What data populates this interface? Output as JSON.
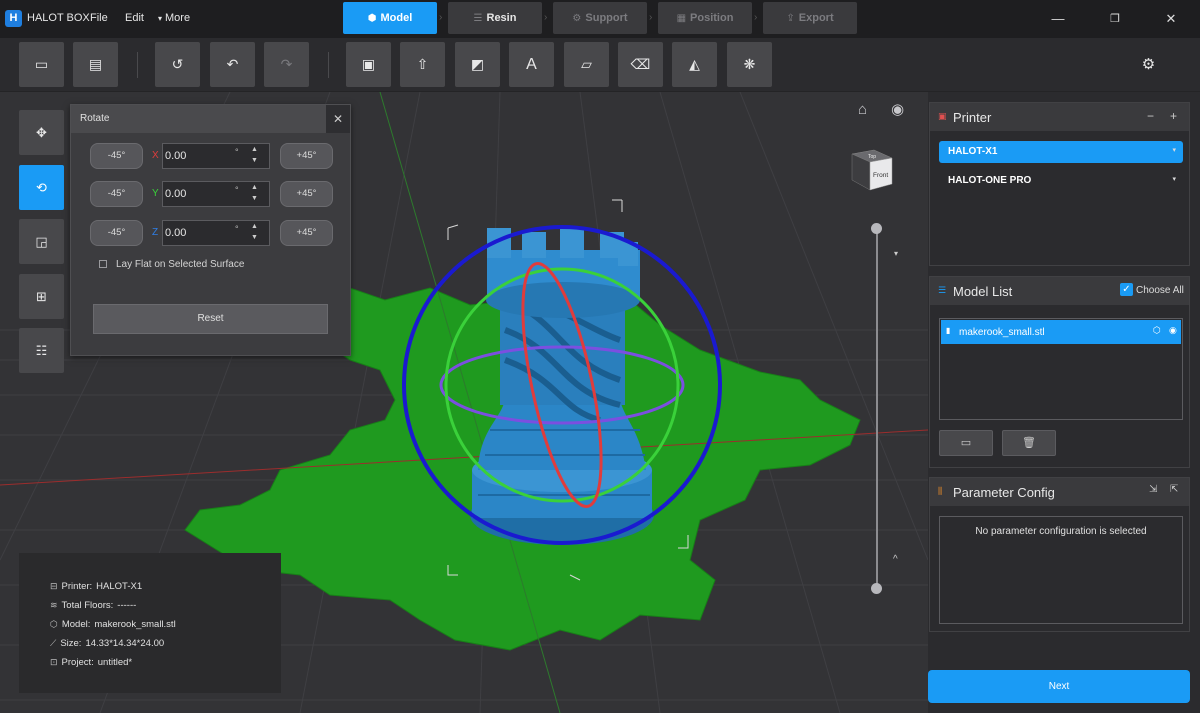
{
  "app": {
    "title": "HALOT BOX",
    "logo_letter": "H"
  },
  "menu": {
    "file": "File",
    "edit": "Edit",
    "more": "More"
  },
  "tabs": [
    {
      "label": "Model",
      "active": true
    },
    {
      "label": "Resin",
      "active": false
    },
    {
      "label": "Support",
      "active": false
    },
    {
      "label": "Position",
      "active": false
    },
    {
      "label": "Export",
      "active": false
    }
  ],
  "rotate": {
    "title": "Rotate",
    "minus_label": "-45°",
    "plus_label": "+45°",
    "x": {
      "axis": "X",
      "value": "0.00"
    },
    "y": {
      "axis": "Y",
      "value": "0.00"
    },
    "z": {
      "axis": "Z",
      "value": "0.00"
    },
    "unit": "°",
    "lay_flat_label": "Lay Flat on Selected Surface",
    "reset_label": "Reset"
  },
  "view_cube": {
    "top_label": "Top",
    "front_label": "Front"
  },
  "info": {
    "printer_label": "Printer:",
    "printer_value": "HALOT-X1",
    "floors_label": "Total Floors:",
    "floors_value": "------",
    "model_label": "Model:",
    "model_value": "makerook_small.stl",
    "size_label": "Size:",
    "size_value": "14.33*14.34*24.00",
    "project_label": "Project:",
    "project_value": "untitled*"
  },
  "printer_panel": {
    "title": "Printer",
    "printers": [
      "HALOT-X1",
      "HALOT-ONE PRO"
    ],
    "selected": "HALOT-X1"
  },
  "model_list": {
    "title": "Model List",
    "choose_all_label": "Choose All",
    "choose_all_checked": true,
    "items": [
      "makerook_small.stl"
    ]
  },
  "param_config": {
    "title": "Parameter Config",
    "empty_text": "No parameter configuration is selected"
  },
  "next_label": "Next",
  "colors": {
    "accent": "#1a9bf5",
    "axis_x": "#e03c3c",
    "axis_y": "#3ad13a",
    "axis_z": "#2f7fe6",
    "plate": "#1f9a1f",
    "model": "#2b86c7"
  }
}
